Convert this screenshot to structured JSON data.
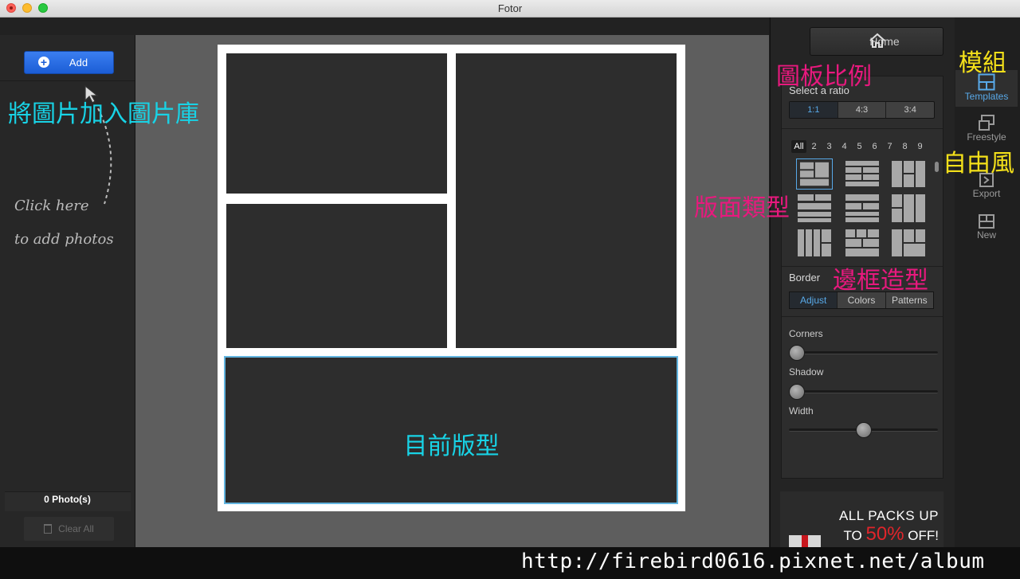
{
  "window": {
    "title": "Fotor"
  },
  "left_panel": {
    "add_label": "Add",
    "hint_line1": "Click here",
    "hint_line2": "to add photos",
    "photo_count": "0 Photo(s)",
    "clear_all_label": "Clear All"
  },
  "canvas": {
    "current_layout_label": "目前版型"
  },
  "right_panel": {
    "home_label": "Home",
    "select_ratio_label": "Select a ratio",
    "ratios": [
      {
        "label": "1:1",
        "active": true
      },
      {
        "label": "4:3",
        "active": false
      },
      {
        "label": "3:4",
        "active": false
      }
    ],
    "photo_counts": [
      "All",
      "2",
      "3",
      "4",
      "5",
      "6",
      "7",
      "8",
      "9"
    ],
    "border_label": "Border",
    "border_tabs": [
      {
        "label": "Adjust",
        "active": true
      },
      {
        "label": "Colors",
        "active": false
      },
      {
        "label": "Patterns",
        "active": false
      }
    ],
    "sliders": [
      {
        "label": "Corners",
        "value": 0.0
      },
      {
        "label": "Shadow",
        "value": 0.0
      },
      {
        "label": "Width",
        "value": 0.5
      }
    ]
  },
  "toolbar": {
    "templates_label": "Templates",
    "freestyle_label": "Freestyle",
    "export_label": "Export",
    "new_label": "New"
  },
  "promo": {
    "line1": "ALL PACKS UP",
    "line2_prefix": "TO",
    "line2_pct": "50%",
    "line2_suffix": "OFF!"
  },
  "annotations": {
    "add_photos": "將圖片加入圖片庫",
    "ratio": "圖板比例",
    "layout_type": "版面類型",
    "border_style": "邊框造型",
    "templates": "模組",
    "freestyle": "自由風"
  },
  "watermark": {
    "url": "http://firebird0616.pixnet.net/album"
  },
  "colors": {
    "accent_blue": "#58a9e8",
    "add_button": "#2a6de3",
    "annotation_cyan": "#18d3e6",
    "annotation_pink": "#e8197e",
    "annotation_yellow": "#f4e01a",
    "promo_red": "#e0252b"
  }
}
